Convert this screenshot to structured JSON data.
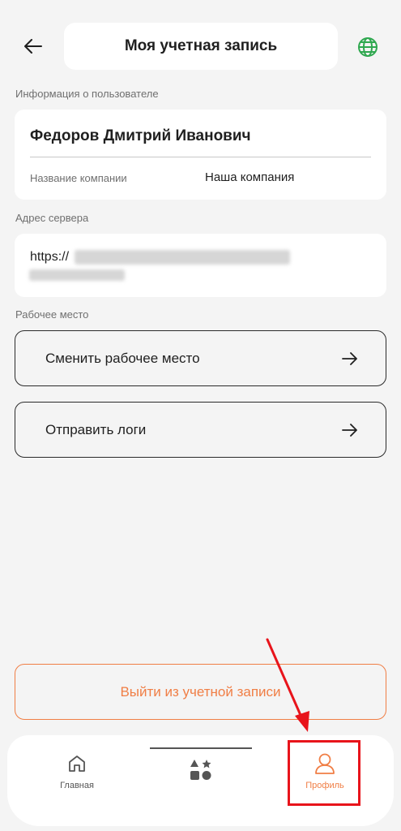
{
  "header": {
    "title": "Моя учетная запись",
    "back_icon": "arrow-left-icon",
    "language_icon": "globe-icon"
  },
  "user_info": {
    "section_label": "Информация о пользователе",
    "full_name": "Федоров Дмитрий Иванович",
    "company_label": "Название компании",
    "company_value": "Наша компания"
  },
  "server": {
    "section_label": "Адрес сервера",
    "url_prefix": "https://"
  },
  "workplace": {
    "section_label": "Рабочее место",
    "change_workplace_label": "Сменить рабочее место",
    "send_logs_label": "Отправить логи"
  },
  "logout": {
    "label": "Выйти из учетной записи"
  },
  "bottom_nav": {
    "items": [
      {
        "label": "Главная",
        "icon": "home-icon",
        "active": false
      },
      {
        "label": "",
        "icon": "apps-icon",
        "active": false
      },
      {
        "label": "Профиль",
        "icon": "profile-icon",
        "active": true
      }
    ]
  },
  "colors": {
    "background": "#f4f4f4",
    "accent": "#f07e45",
    "globe": "#2fa84f",
    "annotation": "#e8141b"
  }
}
